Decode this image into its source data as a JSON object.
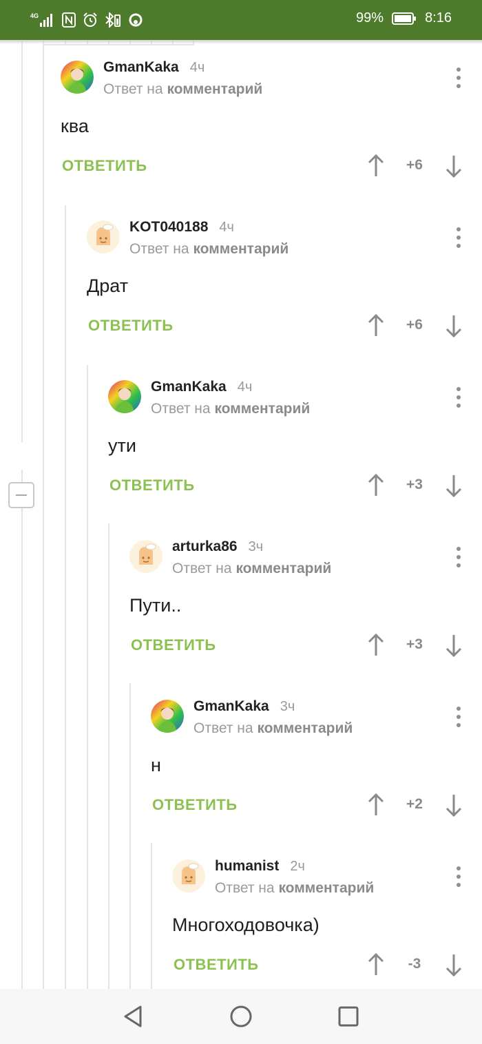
{
  "status_bar": {
    "network": "4G",
    "battery_percent": "99%",
    "time": "8:16",
    "icons": [
      "signal-icon",
      "nfc-icon",
      "alarm-icon",
      "bluetooth-icon",
      "sync-icon",
      "battery-icon"
    ]
  },
  "comments": [
    {
      "username": "GmanKaka",
      "time": "4ч",
      "reply_prefix": "Ответ на",
      "reply_target": "комментарий",
      "text": "ква",
      "reply_label": "ОТВЕТИТЬ",
      "score": "+6",
      "avatar": "rainbow"
    },
    {
      "username": "KOT040188",
      "time": "4ч",
      "reply_prefix": "Ответ на",
      "reply_target": "комментарий",
      "text": "Драт",
      "reply_label": "ОТВЕТИТЬ",
      "score": "+6",
      "avatar": "default"
    },
    {
      "username": "GmanKaka",
      "time": "4ч",
      "reply_prefix": "Ответ на",
      "reply_target": "комментарий",
      "text": "ути",
      "reply_label": "ОТВЕТИТЬ",
      "score": "+3",
      "avatar": "rainbow"
    },
    {
      "username": "arturka86",
      "time": "3ч",
      "reply_prefix": "Ответ на",
      "reply_target": "комментарий",
      "text": "Пути..",
      "reply_label": "ОТВЕТИТЬ",
      "score": "+3",
      "avatar": "default"
    },
    {
      "username": "GmanKaka",
      "time": "3ч",
      "reply_prefix": "Ответ на",
      "reply_target": "комментарий",
      "text": "н",
      "reply_label": "ОТВЕТИТЬ",
      "score": "+2",
      "avatar": "rainbow"
    },
    {
      "username": "humanist",
      "time": "2ч",
      "reply_prefix": "Ответ на",
      "reply_target": "комментарий",
      "text": "Многоходовочка)",
      "reply_label": "ОТВЕТИТЬ",
      "score": "-3",
      "avatar": "default"
    }
  ],
  "colors": {
    "status_bar": "#4e7a2c",
    "reply_button": "#8cc152",
    "thread_line": "#e4e4e4"
  },
  "nav_bar": {
    "icons": [
      "back-icon",
      "home-icon",
      "recents-icon"
    ]
  }
}
